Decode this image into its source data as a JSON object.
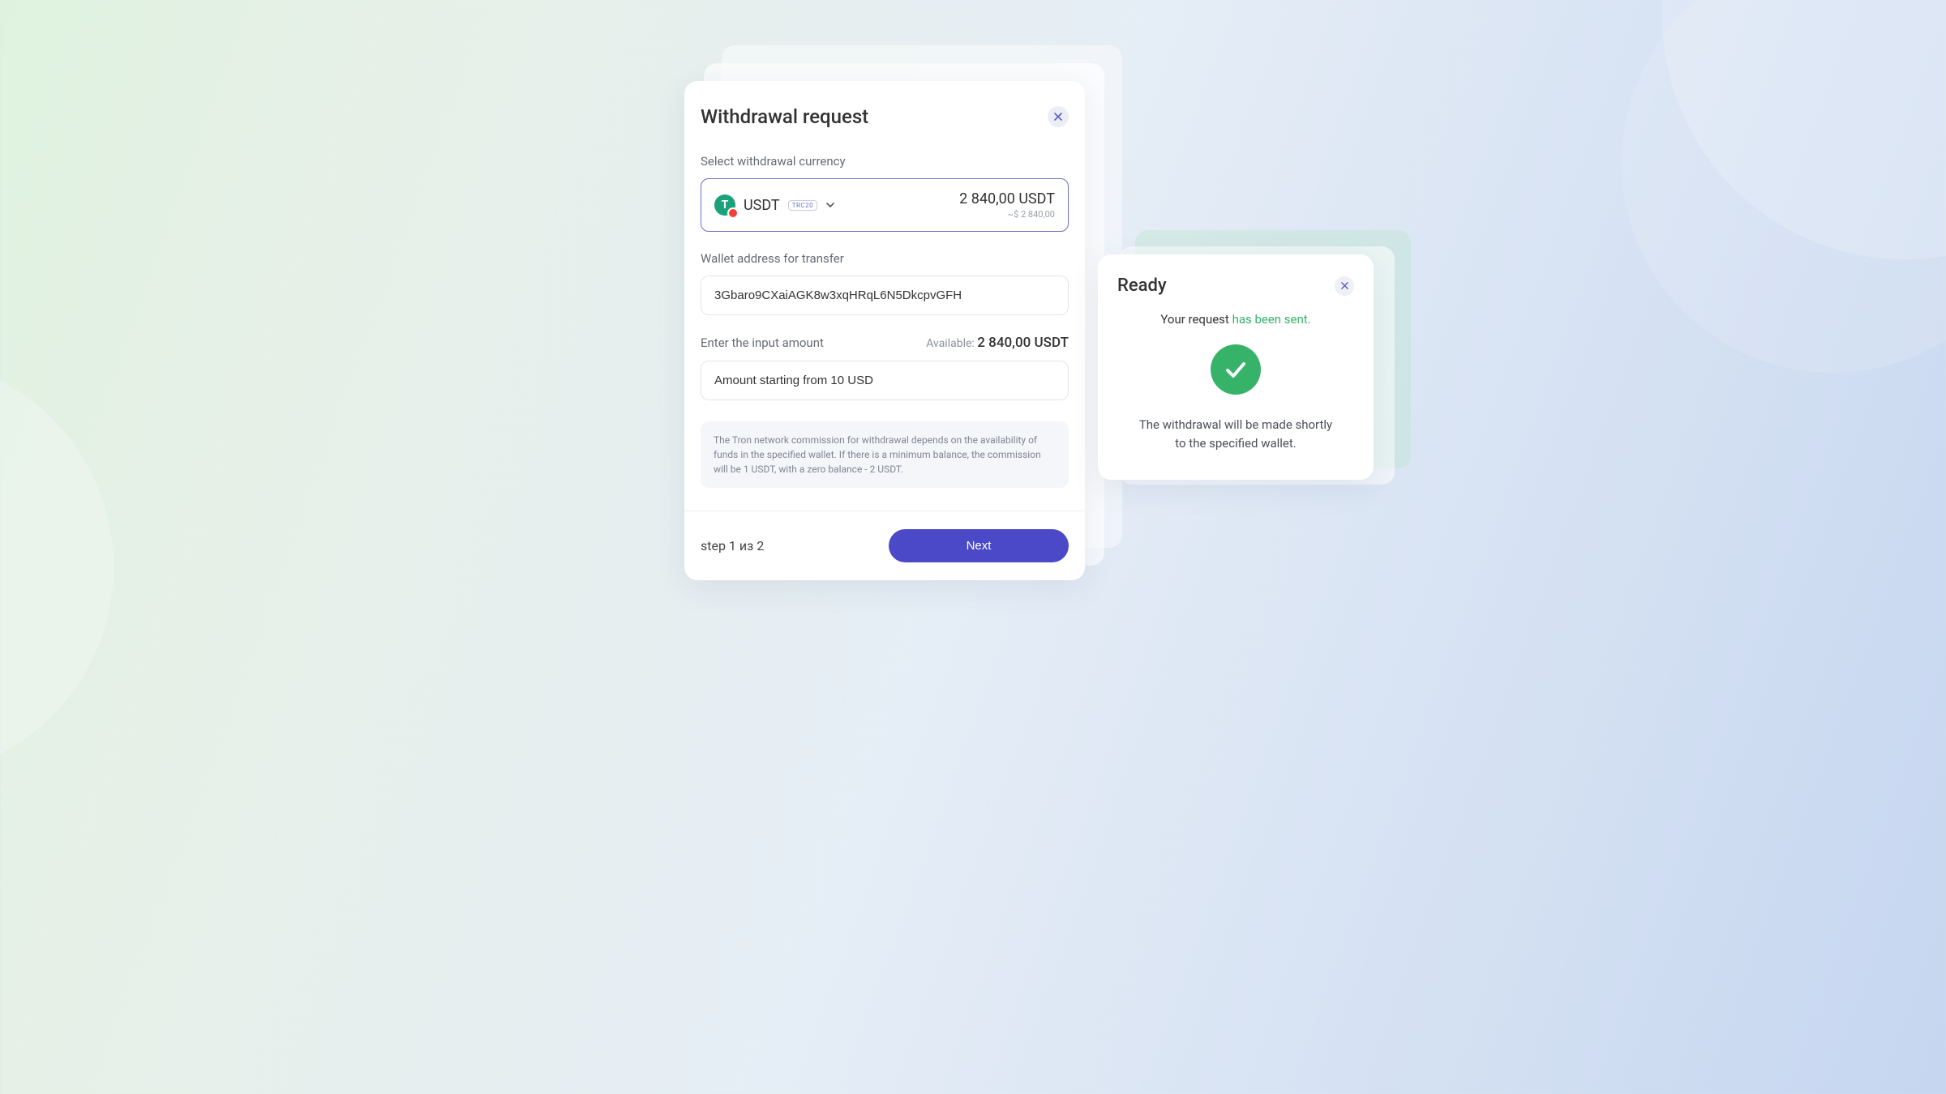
{
  "withdraw": {
    "title": "Withdrawal request",
    "select_label": "Select withdrawal currency",
    "currency": {
      "symbol": "USDT",
      "network_badge": "TRC20",
      "balance": "2 840,00 USDT",
      "balance_fiat": "~$ 2 840,00",
      "coin_letter": "T"
    },
    "wallet_label": "Wallet address for transfer",
    "wallet_value": "3Gbaro9CXaiAGK8w3xqHRqL6N5DkcpvGFH",
    "amount_label": "Enter the input amount",
    "available_label": "Available:",
    "available_value": "2 840,00 USDT",
    "amount_placeholder": "Amount starting from 10 USD",
    "note": "The Tron network commission for withdrawal depends on the availability of funds in the specified wallet. If there is a minimum balance, the commission will be 1 USDT, with a zero balance - 2 USDT.",
    "step_text": "step 1 из 2",
    "next_label": "Next"
  },
  "ready": {
    "title": "Ready",
    "msg_prefix": "Your request ",
    "msg_highlight": "has been sent.",
    "description_line1": "The withdrawal will be made shortly",
    "description_line2": "to the specified wallet."
  },
  "colors": {
    "primary": "#4b49c8",
    "success": "#36b368"
  }
}
